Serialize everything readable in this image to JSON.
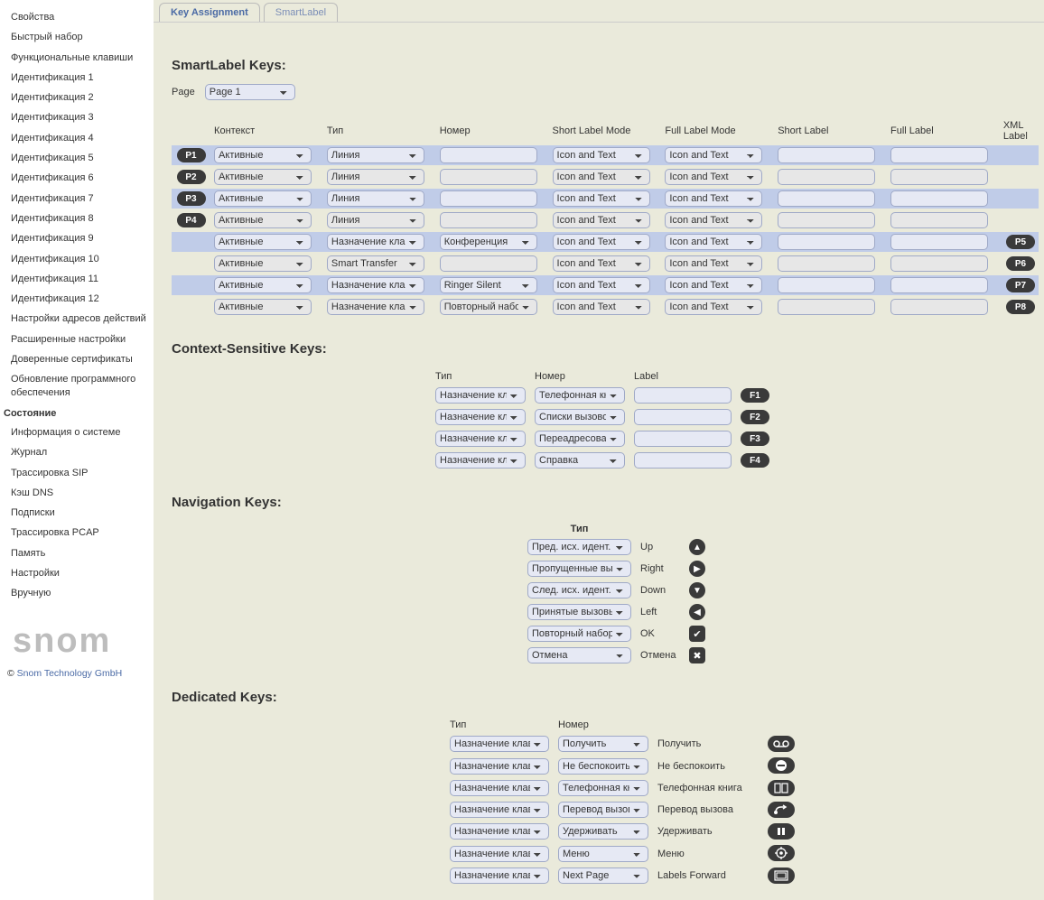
{
  "sidebar": {
    "items": [
      {
        "label": "Свойства"
      },
      {
        "label": "Быстрый набор"
      },
      {
        "label": "Функциональные клавиши"
      },
      {
        "label": "Идентификация 1"
      },
      {
        "label": "Идентификация 2"
      },
      {
        "label": "Идентификация 3"
      },
      {
        "label": "Идентификация 4"
      },
      {
        "label": "Идентификация 5"
      },
      {
        "label": "Идентификация 6"
      },
      {
        "label": "Идентификация 7"
      },
      {
        "label": "Идентификация 8"
      },
      {
        "label": "Идентификация 9"
      },
      {
        "label": "Идентификация 10"
      },
      {
        "label": "Идентификация 11"
      },
      {
        "label": "Идентификация 12"
      },
      {
        "label": "Настройки адресов действий"
      },
      {
        "label": "Расширенные настройки"
      },
      {
        "label": "Доверенные сертификаты"
      },
      {
        "label": "Обновление программного обеспечения"
      }
    ],
    "state_head": "Состояние",
    "state_items": [
      {
        "label": "Информация о системе"
      },
      {
        "label": "Журнал"
      },
      {
        "label": "Трассировка SIP"
      },
      {
        "label": "Кэш DNS"
      },
      {
        "label": "Подписки"
      },
      {
        "label": "Трассировка PCAP"
      },
      {
        "label": "Память"
      },
      {
        "label": "Настройки"
      },
      {
        "label": "Вручную"
      }
    ],
    "logo": "snom",
    "copyright_prefix": "© ",
    "copyright_link": "Snom Technology GmbH"
  },
  "tabs": {
    "key_assignment": "Key Assignment",
    "smartlabel": "SmartLabel"
  },
  "page_select": {
    "label": "Page",
    "value": "Page 1"
  },
  "smartlabel": {
    "title": "SmartLabel Keys:",
    "headers": {
      "context": "Контекст",
      "type": "Тип",
      "number": "Номер",
      "slm": "Short Label Mode",
      "flm": "Full Label Mode",
      "short": "Short Label",
      "full": "Full Label",
      "xml": "XML Label"
    },
    "rows": [
      {
        "pk": "P1",
        "pk_pos": "left",
        "blue": true,
        "ctx": "Активные",
        "type": "Линия",
        "num": "",
        "slm": "Icon and Text",
        "flm": "Icon and Text"
      },
      {
        "pk": "P2",
        "pk_pos": "left",
        "blue": false,
        "ctx": "Активные",
        "type": "Линия",
        "num": "",
        "slm": "Icon and Text",
        "flm": "Icon and Text"
      },
      {
        "pk": "P3",
        "pk_pos": "left",
        "blue": true,
        "ctx": "Активные",
        "type": "Линия",
        "num": "",
        "slm": "Icon and Text",
        "flm": "Icon and Text"
      },
      {
        "pk": "P4",
        "pk_pos": "left",
        "blue": false,
        "ctx": "Активные",
        "type": "Линия",
        "num": "",
        "slm": "Icon and Text",
        "flm": "Icon and Text"
      },
      {
        "pk": "P5",
        "pk_pos": "right",
        "blue": true,
        "ctx": "Активные",
        "type": "Назначение клавиши",
        "num": "Конференция",
        "slm": "Icon and Text",
        "flm": "Icon and Text"
      },
      {
        "pk": "P6",
        "pk_pos": "right",
        "blue": false,
        "ctx": "Активные",
        "type": "Smart Transfer",
        "num": "",
        "slm": "Icon and Text",
        "flm": "Icon and Text"
      },
      {
        "pk": "P7",
        "pk_pos": "right",
        "blue": true,
        "ctx": "Активные",
        "type": "Назначение клавиши",
        "num": "Ringer Silent",
        "slm": "Icon and Text",
        "flm": "Icon and Text"
      },
      {
        "pk": "P8",
        "pk_pos": "right",
        "blue": false,
        "ctx": "Активные",
        "type": "Назначение клавиши",
        "num": "Повторный набор номера",
        "slm": "Icon and Text",
        "flm": "Icon and Text"
      }
    ]
  },
  "context_keys": {
    "title": "Context-Sensitive Keys:",
    "headers": {
      "type": "Тип",
      "number": "Номер",
      "label": "Label"
    },
    "rows": [
      {
        "type": "Назначение клавиши",
        "num": "Телефонная книга",
        "fk": "F1"
      },
      {
        "type": "Назначение клавиши",
        "num": "Списки вызовов",
        "fk": "F2"
      },
      {
        "type": "Назначение клавиши",
        "num": "Переадресовать",
        "fk": "F3"
      },
      {
        "type": "Назначение клавиши",
        "num": "Справка",
        "fk": "F4"
      }
    ]
  },
  "nav_keys": {
    "title": "Navigation Keys:",
    "header": "Тип",
    "rows": [
      {
        "type": "Пред. исх. идент.",
        "label": "Up",
        "icon": "▲"
      },
      {
        "type": "Пропущенные вызовы",
        "label": "Right",
        "icon": "▶"
      },
      {
        "type": "След. исх. идент.",
        "label": "Down",
        "icon": "▼"
      },
      {
        "type": "Принятые вызовы",
        "label": "Left",
        "icon": "◀"
      },
      {
        "type": "Повторный набор номера",
        "label": "OK",
        "icon": "✔"
      },
      {
        "type": "Отмена",
        "label": "Отмена",
        "icon": "✖"
      }
    ]
  },
  "ded_keys": {
    "title": "Dedicated Keys:",
    "headers": {
      "type": "Тип",
      "number": "Номер"
    },
    "rows": [
      {
        "type": "Назначение клавиши",
        "num": "Получить",
        "label": "Получить",
        "icon": "voicemail"
      },
      {
        "type": "Назначение клавиши",
        "num": "Не беспокоить",
        "label": "Не беспокоить",
        "icon": "dnd"
      },
      {
        "type": "Назначение клавиши",
        "num": "Телефонная книга",
        "label": "Телефонная книга",
        "icon": "book"
      },
      {
        "type": "Назначение клавиши",
        "num": "Перевод вызова",
        "label": "Перевод вызова",
        "icon": "transfer"
      },
      {
        "type": "Назначение клавиши",
        "num": "Удерживать",
        "label": "Удерживать",
        "icon": "hold"
      },
      {
        "type": "Назначение клавиши",
        "num": "Меню",
        "label": "Меню",
        "icon": "menu"
      },
      {
        "type": "Назначение клавиши",
        "num": "Next Page",
        "label": "Labels Forward",
        "icon": "page"
      }
    ]
  }
}
